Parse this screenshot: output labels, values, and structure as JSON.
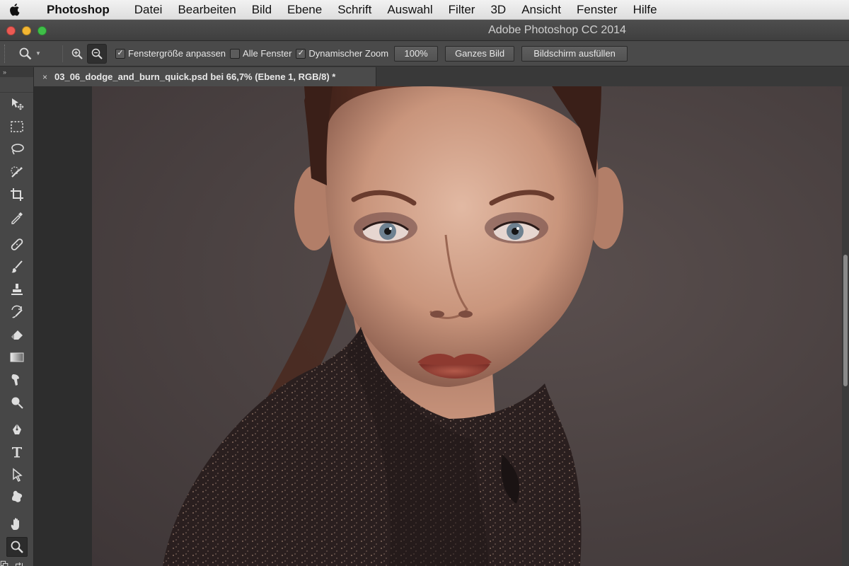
{
  "menubar": {
    "app_name": "Photoshop",
    "items": [
      "Datei",
      "Bearbeiten",
      "Bild",
      "Ebene",
      "Schrift",
      "Auswahl",
      "Filter",
      "3D",
      "Ansicht",
      "Fenster",
      "Hilfe"
    ]
  },
  "window": {
    "title": "Adobe Photoshop CC 2014"
  },
  "options": {
    "resize_windows_label": "Fenstergröße anpassen",
    "resize_windows_checked": true,
    "all_windows_label": "Alle Fenster",
    "all_windows_checked": false,
    "scrubby_zoom_label": "Dynamischer Zoom",
    "scrubby_zoom_checked": true,
    "percent_button": "100%",
    "fit_screen_button": "Ganzes Bild",
    "fill_screen_button": "Bildschirm ausfüllen"
  },
  "document": {
    "tab_label": "03_06_dodge_and_burn_quick.psd bei 66,7% (Ebene 1, RGB/8) *",
    "close_glyph": "×"
  },
  "toolpanel": {
    "collapse_glyph": "»",
    "tools": [
      "move-tool-icon",
      "marquee-tool-icon",
      "lasso-tool-icon",
      "quick-selection-tool-icon",
      "crop-tool-icon",
      "eyedropper-tool-icon",
      "healing-brush-tool-icon",
      "brush-tool-icon",
      "clone-stamp-tool-icon",
      "history-brush-tool-icon",
      "eraser-tool-icon",
      "gradient-tool-icon",
      "smudge-tool-icon",
      "dodge-tool-icon",
      "pen-tool-icon",
      "type-tool-icon",
      "path-selection-tool-icon",
      "custom-shape-tool-icon",
      "hand-tool-icon",
      "zoom-tool-icon"
    ],
    "selected": "zoom-tool-icon"
  },
  "colors": {
    "ui_dark": "#474747",
    "accent_close": "#ec5a53",
    "accent_min": "#f3b632",
    "accent_max": "#3fbf48"
  }
}
